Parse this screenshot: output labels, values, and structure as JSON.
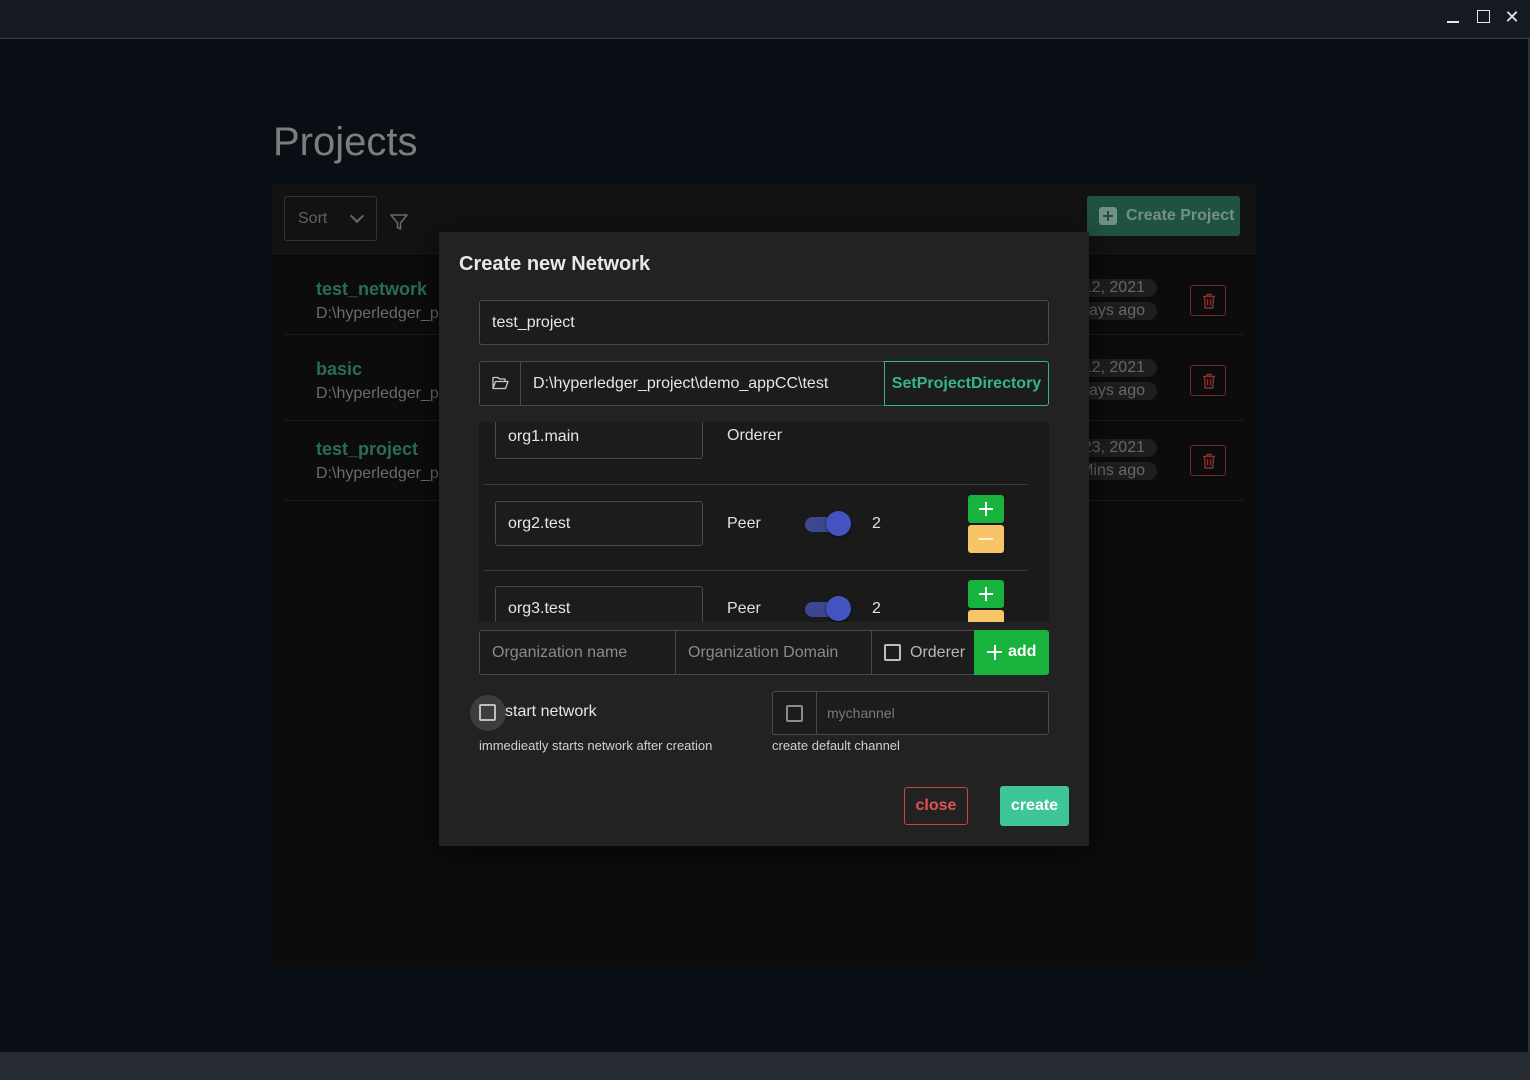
{
  "window": {
    "minimize_icon": "minimize-icon",
    "maximize_icon": "maximize-icon",
    "close_glyph": "✕"
  },
  "page": {
    "title": "Projects"
  },
  "toolbar": {
    "sort_label": "Sort",
    "create_project_label": "Create Project"
  },
  "projects": [
    {
      "name": "test_network",
      "path": "D:\\hyperledger_pr",
      "date": "12, 2021",
      "ago": "ays ago"
    },
    {
      "name": "basic",
      "path": "D:\\hyperledger_pr",
      "date": "12, 2021",
      "ago": "ays ago"
    },
    {
      "name": "test_project",
      "path": "D:\\hyperledger_pr",
      "date": "23, 2021",
      "ago": "Mins ago"
    }
  ],
  "modal": {
    "title": "Create new Network",
    "project_name": "test_project",
    "directory": "D:\\hyperledger_project\\demo_appCC\\test",
    "set_directory_label": "SetProjectDirectory",
    "organizations": [
      {
        "name": "org1.main",
        "type": "Orderer"
      },
      {
        "name": "org2.test",
        "type": "Peer",
        "peer_count": "2"
      },
      {
        "name": "org3.test",
        "type": "Peer",
        "peer_count": "2"
      }
    ],
    "add_org": {
      "name_placeholder": "Organization name",
      "domain_placeholder": "Organization Domain",
      "orderer_label": "Orderer",
      "add_label": "add"
    },
    "start_network": {
      "label": "start network",
      "help": "immedieatly starts network after creation"
    },
    "channel": {
      "placeholder": "mychannel",
      "help": "create default channel"
    },
    "close_label": "close",
    "create_label": "create"
  },
  "colors": {
    "accent_green": "#3fa07e",
    "add_green": "#17b33c",
    "minus_yellow": "#f7c567",
    "danger_red": "#c64646",
    "toggle_blue": "#4353c0"
  }
}
